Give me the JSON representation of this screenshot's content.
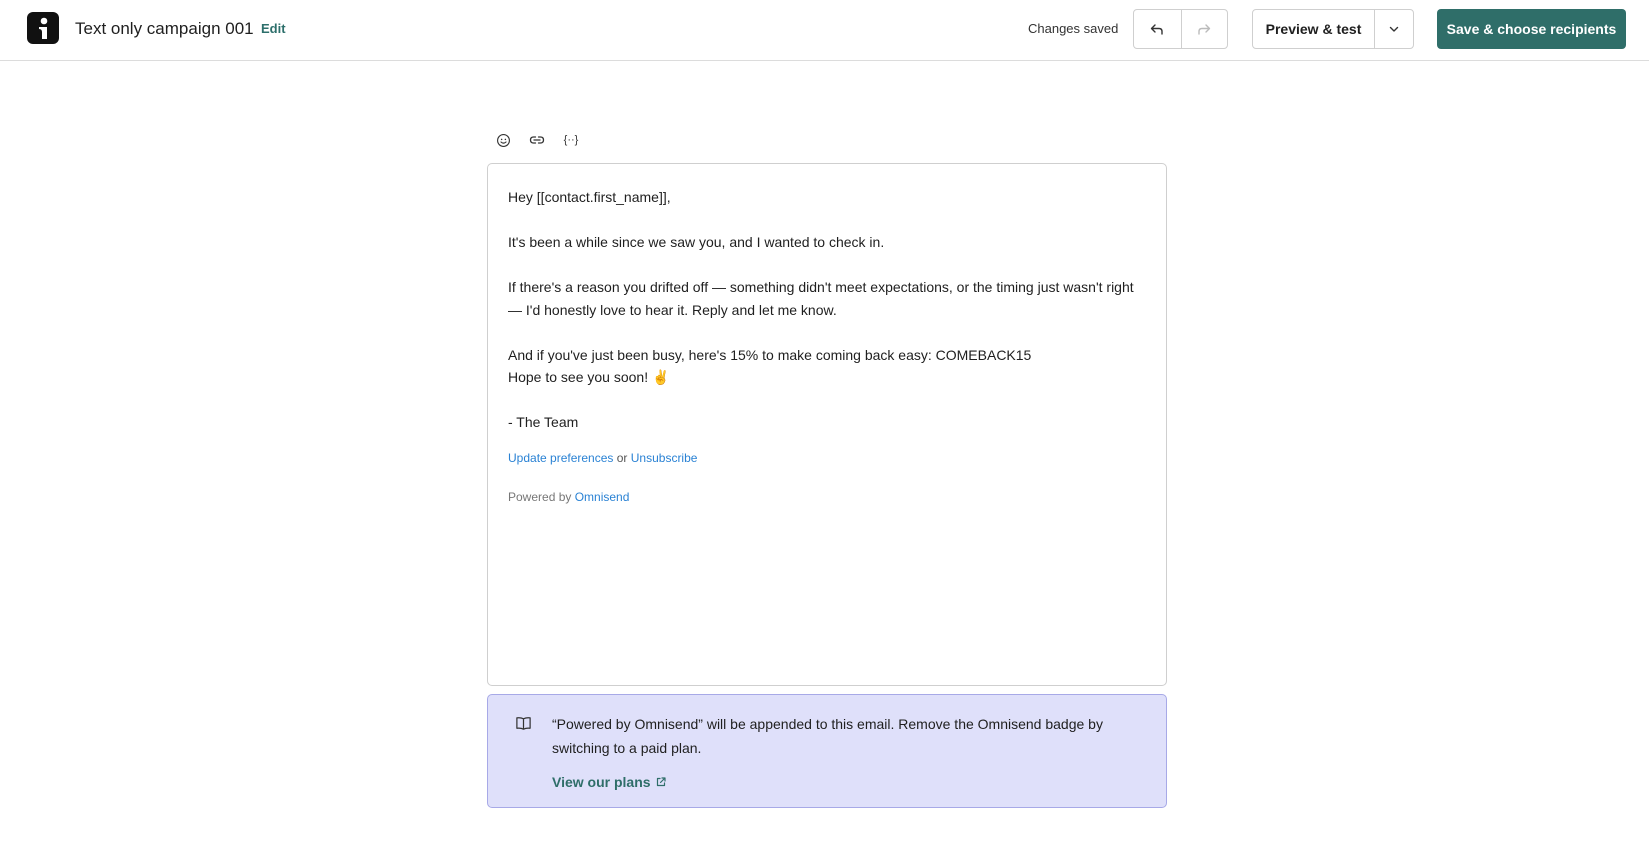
{
  "header": {
    "title": "Text only campaign 001",
    "edit_label": "Edit",
    "status": "Changes saved",
    "preview_label": "Preview & test",
    "save_label": "Save & choose recipients"
  },
  "toolbar": {
    "icons": [
      "emoji-icon",
      "link-icon",
      "merge-tag-icon"
    ],
    "merge_tag_glyph": "{··}"
  },
  "editor": {
    "greeting": "Hey [[contact.first_name]],",
    "para1": "It's been a while since we saw you, and I wanted to check in.",
    "para2": "If there's a reason you drifted off — something didn't meet expectations, or the timing just wasn't right — I'd honestly love to hear it. Reply and let me know.",
    "para3_line1": "And if you've just been busy, here's 15% to make coming back easy: COMEBACK15",
    "para3_line2": "Hope to see you soon! ✌️",
    "signoff": "- The Team",
    "update_prefs": "Update preferences",
    "or": " or ",
    "unsubscribe": "Unsubscribe",
    "powered_by": "Powered by ",
    "omnisend": "Omnisend"
  },
  "banner": {
    "message": "“Powered by Omnisend” will be appended to this email. Remove the Omnisend badge by switching to a paid plan.",
    "link_label": "View our plans"
  },
  "colors": {
    "primary": "#2f6e69",
    "link": "#2a82d4",
    "banner_bg": "#dfe0fa",
    "banner_border": "#a7a9e7"
  }
}
